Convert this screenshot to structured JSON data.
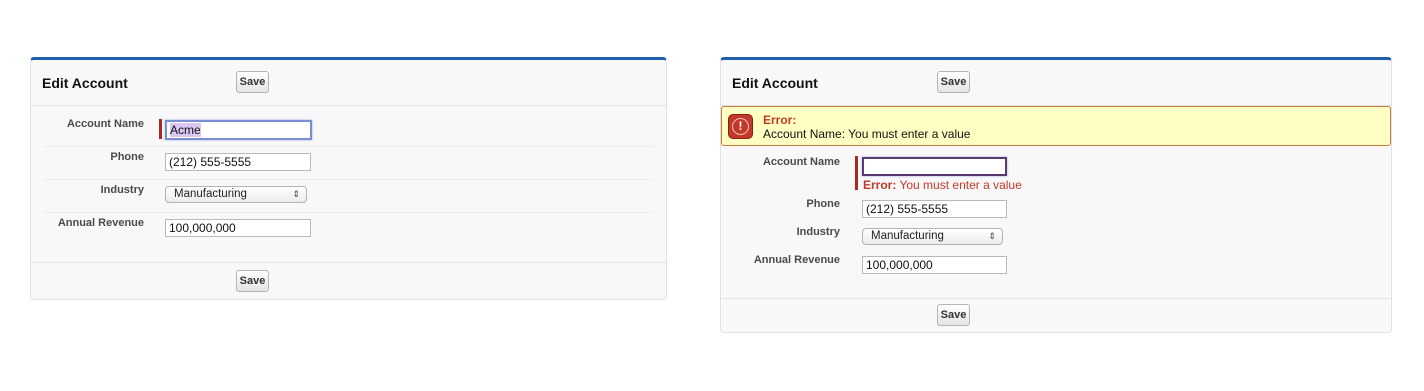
{
  "left_form": {
    "title": "Edit Account",
    "save_label": "Save",
    "fields": {
      "account_name": {
        "label": "Account Name",
        "value": "Acme"
      },
      "phone": {
        "label": "Phone",
        "value": "(212) 555-5555"
      },
      "industry": {
        "label": "Industry",
        "value": "Manufacturing"
      },
      "annual_revenue": {
        "label": "Annual Revenue",
        "value": "100,000,000"
      }
    }
  },
  "right_form": {
    "title": "Edit Account",
    "save_label": "Save",
    "error": {
      "title": "Error:",
      "message": "Account Name: You must enter a value"
    },
    "fields": {
      "account_name": {
        "label": "Account Name",
        "value": "",
        "error_prefix": "Error:",
        "error_text": "You must enter a value"
      },
      "phone": {
        "label": "Phone",
        "value": "(212) 555-5555"
      },
      "industry": {
        "label": "Industry",
        "value": "Manufacturing"
      },
      "annual_revenue": {
        "label": "Annual Revenue",
        "value": "100,000,000"
      }
    }
  },
  "colors": {
    "header_border": "#1f5ea8",
    "required_bar": "#a62a1e",
    "error": "#c0392b",
    "error_bg": "#ffffc3"
  },
  "icons": {
    "select_arrow": "⇕",
    "error_icon": "!"
  }
}
